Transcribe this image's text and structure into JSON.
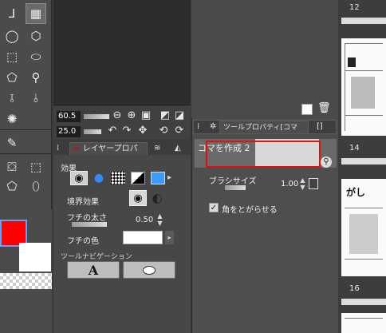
{
  "nav": {
    "zoom_value": "60.5",
    "rotate_value": "25.0"
  },
  "left_panel": {
    "tabs": [
      "レイヤープロパ"
    ],
    "effect_label": "効果",
    "border_effect_label": "境界効果",
    "border_width_label": "フチの太さ",
    "border_width_value": "0.50",
    "border_color_label": "フチの色",
    "tool_nav_label": "ツールナビゲーション",
    "text_button_glyph": "A"
  },
  "mid_panel": {
    "tab_label": "ツールプロパティ[コマ",
    "tool_name": "コマを作成 2",
    "brush_size_label": "ブラシサイズ",
    "brush_size_value": "1.00",
    "corner_checkbox_label": "角をとがらせる",
    "corner_checked": true
  },
  "pages": {
    "numbers": [
      "12",
      "14",
      "16"
    ],
    "thumb_text": "がし"
  },
  "colors": {
    "main": "#ff0000",
    "sub": "#ffffff",
    "highlight": "#e01010"
  },
  "icons": {
    "tools": [
      "pen-icon",
      "ellipse-icon",
      "hexagon-icon",
      "rect-select-icon",
      "ellipse-select-icon",
      "lasso-icon",
      "wand-icon",
      "blob-icon",
      "brush-icon"
    ],
    "nav": [
      "zoom-out-icon",
      "zoom-in-icon",
      "fit-icon",
      "flip-h-icon",
      "flip-v-icon",
      "rotate-left-icon",
      "rotate-right-icon",
      "reset-rotate-icon"
    ]
  }
}
